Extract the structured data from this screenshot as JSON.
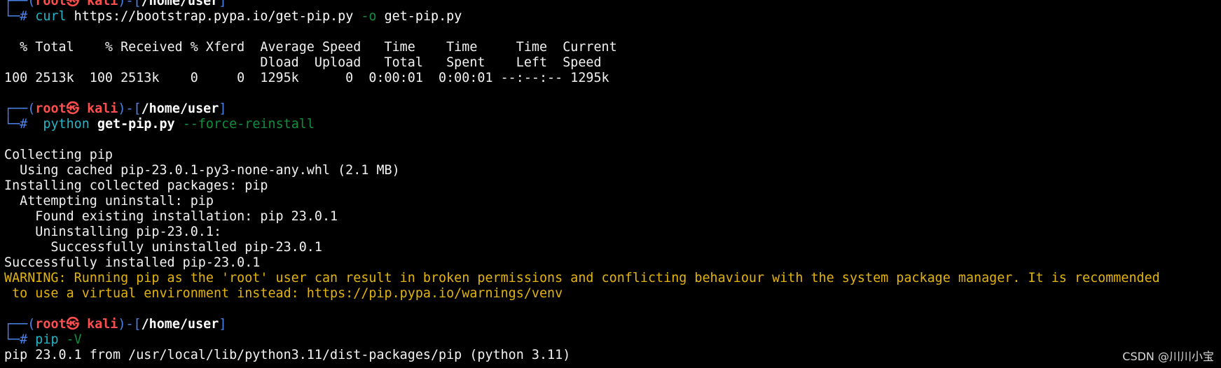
{
  "prompt": {
    "open": "┌──(",
    "user": "root",
    "at": "㉿",
    "host": "kali",
    "mid": ")-[",
    "path": "/home/user",
    "close": "]",
    "hash": "└─#"
  },
  "commands": {
    "curl": {
      "cmd": "curl",
      "url": "https://bootstrap.pypa.io/get-pip.py",
      "flag": "-o",
      "target": "get-pip.py"
    },
    "python": {
      "cmd": "python",
      "script": "get-pip.py",
      "flag": "--force-reinstall"
    },
    "pip": {
      "cmd": "pip",
      "flag": "-V"
    }
  },
  "curl_progress": {
    "header1": "  % Total    % Received % Xferd  Average Speed   Time    Time     Time  Current",
    "header2": "                                 Dload  Upload   Total   Spent    Left  Speed",
    "row": "100 2513k  100 2513k    0     0  1295k      0  0:00:01  0:00:01 --:--:-- 1295k"
  },
  "pip_install_output": [
    "Collecting pip",
    "  Using cached pip-23.0.1-py3-none-any.whl (2.1 MB)",
    "Installing collected packages: pip",
    "  Attempting uninstall: pip",
    "    Found existing installation: pip 23.0.1",
    "    Uninstalling pip-23.0.1:",
    "      Successfully uninstalled pip-23.0.1",
    "Successfully installed pip-23.0.1"
  ],
  "warning": [
    "WARNING: Running pip as the 'root' user can result in broken permissions and conflicting behaviour with the system package manager. It is recommended",
    " to use a virtual environment instead: https://pip.pypa.io/warnings/venv"
  ],
  "pip_version_output": "pip 23.0.1 from /usr/local/lib/python3.11/dist-packages/pip (python 3.11)",
  "watermark": "CSDN @川川小宝",
  "colors": {
    "background": "#000000",
    "prompt_frame": "#4a84e8",
    "user_host": "#ff4e4e",
    "command": "#22b5c9",
    "flag": "#0f8f3c",
    "warning": "#e3b40d"
  }
}
